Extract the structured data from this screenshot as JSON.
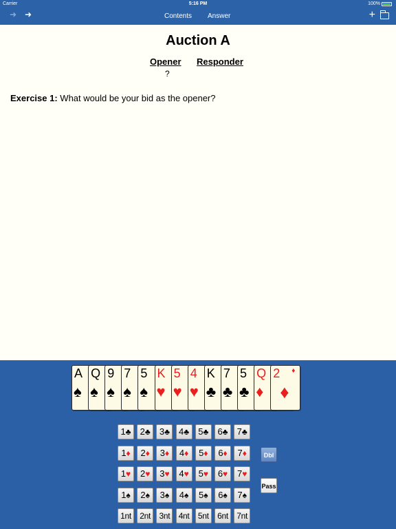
{
  "status_bar": {
    "carrier": "Carrier",
    "time": "5:16 PM",
    "battery": "100%"
  },
  "nav": {
    "contents_label": "Contents",
    "answer_label": "Answer",
    "back_icon": "left-arrow-icon",
    "forward_icon": "right-arrow-icon",
    "add_icon": "plus-icon",
    "folder_icon": "folder-icon"
  },
  "auction": {
    "title": "Auction A",
    "opener_header": "Opener",
    "responder_header": "Responder",
    "opener_bid": "?"
  },
  "exercise": {
    "label": "Exercise 1:",
    "question": "What would be your bid as the opener?"
  },
  "hand": [
    {
      "rank": "A",
      "suit": "♠",
      "color": "black"
    },
    {
      "rank": "Q",
      "suit": "♠",
      "color": "black"
    },
    {
      "rank": "9",
      "suit": "♠",
      "color": "black"
    },
    {
      "rank": "7",
      "suit": "♠",
      "color": "black"
    },
    {
      "rank": "5",
      "suit": "♠",
      "color": "black"
    },
    {
      "rank": "K",
      "suit": "♥",
      "color": "red"
    },
    {
      "rank": "5",
      "suit": "♥",
      "color": "red"
    },
    {
      "rank": "4",
      "suit": "♥",
      "color": "red"
    },
    {
      "rank": "K",
      "suit": "♣",
      "color": "black"
    },
    {
      "rank": "7",
      "suit": "♣",
      "color": "black"
    },
    {
      "rank": "5",
      "suit": "♣",
      "color": "black"
    },
    {
      "rank": "Q",
      "suit": "♦",
      "color": "red"
    },
    {
      "rank": "2",
      "suit": "♦",
      "color": "red"
    }
  ],
  "bidding_box": {
    "levels": [
      "1",
      "2",
      "3",
      "4",
      "5",
      "6",
      "7"
    ],
    "rows": [
      {
        "suit": "♣",
        "color": "black"
      },
      {
        "suit": "♦",
        "color": "red"
      },
      {
        "suit": "♥",
        "color": "red"
      },
      {
        "suit": "♠",
        "color": "black"
      },
      {
        "suit": "nt",
        "color": "black"
      }
    ],
    "double_label": "Dbl",
    "pass_label": "Pass"
  },
  "colors": {
    "nav_blue": "#2c63a8",
    "panel_blue": "#2c60a6",
    "red_suit": "#e8201f",
    "card_face": "#fdfbe5",
    "page_bg": "#fffff7"
  }
}
